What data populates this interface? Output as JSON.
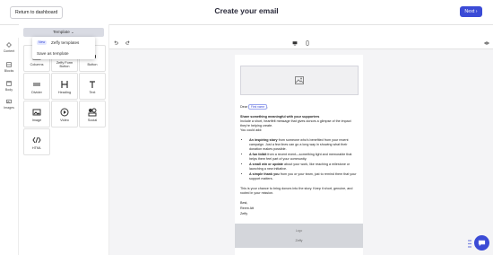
{
  "header": {
    "back_label": "Return to dashboard",
    "title": "Create your email",
    "next_label": "Next ›"
  },
  "rail": {
    "items": [
      {
        "label": "Content",
        "icon": "content-icon"
      },
      {
        "label": "Blocks",
        "icon": "blocks-icon"
      },
      {
        "label": "Body",
        "icon": "body-icon"
      },
      {
        "label": "Images",
        "icon": "images-icon"
      }
    ]
  },
  "panel": {
    "template_label": "Template ⌄",
    "dropdown": {
      "new_badge": "New",
      "zeffy_templates": "Zeffy templates",
      "save_as_template": "Save as template"
    },
    "blocks": [
      {
        "label": "Columns",
        "icon": "columns-icon"
      },
      {
        "label": "Zeffy Form Button",
        "icon": "form-button-icon"
      },
      {
        "label": "Button",
        "icon": "button-icon"
      },
      {
        "label": "Divider",
        "icon": "divider-icon"
      },
      {
        "label": "Heading",
        "icon": "heading-icon"
      },
      {
        "label": "Text",
        "icon": "text-icon"
      },
      {
        "label": "Image",
        "icon": "image-icon"
      },
      {
        "label": "Video",
        "icon": "video-icon"
      },
      {
        "label": "Social",
        "icon": "social-icon"
      },
      {
        "label": "HTML",
        "icon": "html-icon"
      }
    ]
  },
  "email": {
    "greeting": "Dear",
    "first_name_chip": "First name",
    "greeting_end": ",",
    "heading": "Share something meaningful with your supporters",
    "intro": "Include a short, heartfelt message that gives donors a glimpse of the impact they're helping create.",
    "could_add": "You could add:",
    "bullets": [
      {
        "bold": "An inspiring story",
        "rest": " from someone who's benefited from your recent campaign. Just a few lines can go a long way in showing what their donation makes possible."
      },
      {
        "bold": "A fun tidbit",
        "rest": " from a recent event—something light and memorable that helps them feel part of your community."
      },
      {
        "bold": "A small win or update",
        "rest": " about your work, like reaching a milestone or launching a new initiative."
      },
      {
        "bold": "A simple thank you",
        "rest": " from you or your team, just to remind them that your support matters."
      }
    ],
    "closing": "This is your chance to bring donors into the story. Keep it short, genuine, and rooted in your mission.",
    "sign_best": "Best,",
    "sign_name": "Reem Att",
    "sign_org": "Zeffy",
    "footer_alt": "Logo",
    "footer_text": "Zeffy"
  },
  "colors": {
    "accent": "#3b4bd6",
    "canvas_bg": "#f4f4f6",
    "footer_bg": "#d4d6db"
  }
}
